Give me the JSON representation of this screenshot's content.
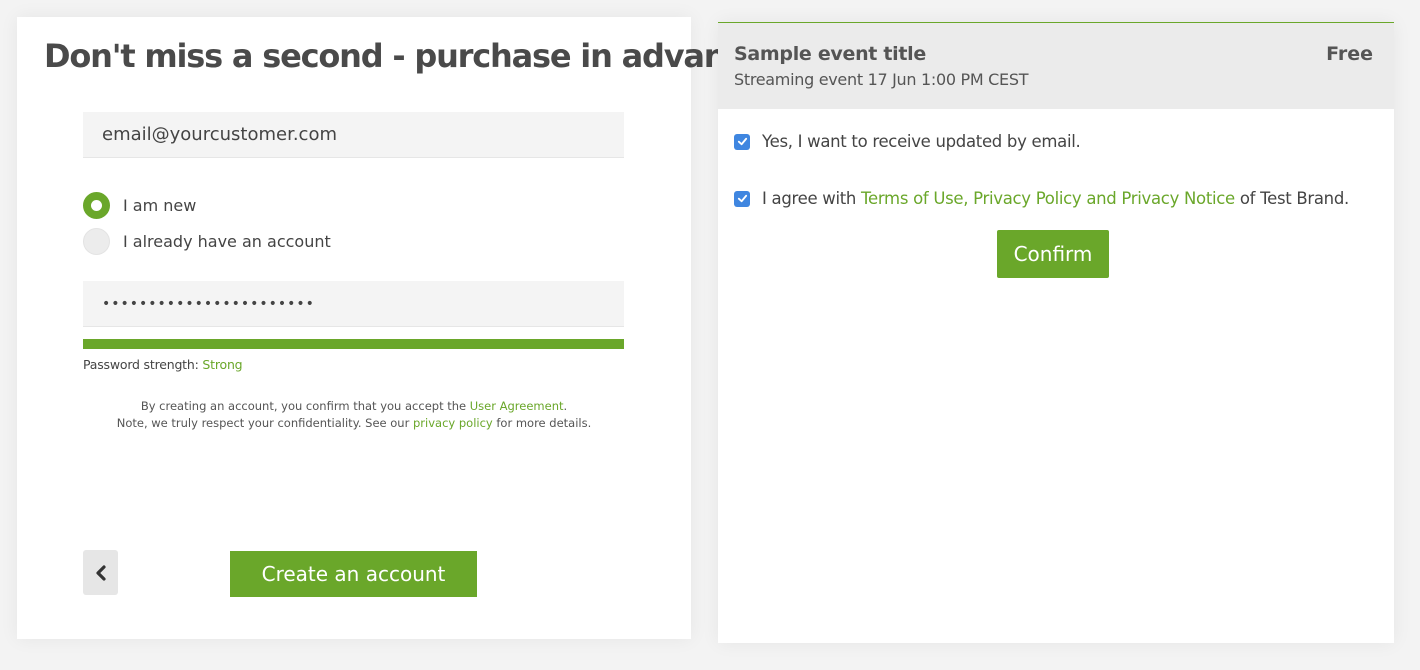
{
  "left": {
    "title": "Don't miss a second - purchase in advance",
    "email_value": "email@yourcustomer.com",
    "radios": [
      {
        "label": "I am new",
        "checked": true
      },
      {
        "label": "I already have an account",
        "checked": false
      }
    ],
    "password_value": "•••••••••••••••••••••••",
    "strength": {
      "label": "Password strength:",
      "value": "Strong",
      "fill_fraction": 1.0
    },
    "legal": {
      "line1_prefix": "By creating an account, you confirm that you accept the",
      "line1_link": "User Agreement",
      "line1_suffix": ".",
      "line2_prefix": "Note, we truly respect your confidentiality. See our",
      "line2_link": "privacy policy",
      "line2_suffix": "for more details."
    },
    "back_icon": "chevron-left-icon",
    "create_label": "Create an account"
  },
  "right": {
    "event_title": "Sample event title",
    "event_price": "Free",
    "event_subtitle": "Streaming event 17 Jun 1:00 PM CEST",
    "checkbox_updates": {
      "label": "Yes, I want to receive updated by email.",
      "checked": true
    },
    "checkbox_terms": {
      "prefix": "I agree with",
      "link": "Terms of Use, Privacy Policy and Privacy Notice",
      "suffix": "of Test Brand.",
      "checked": true
    },
    "confirm_label": "Confirm"
  },
  "colors": {
    "accent_green": "#6aa72a",
    "checkbox_blue": "#3f86e0",
    "header_gray": "#ebebeb"
  }
}
